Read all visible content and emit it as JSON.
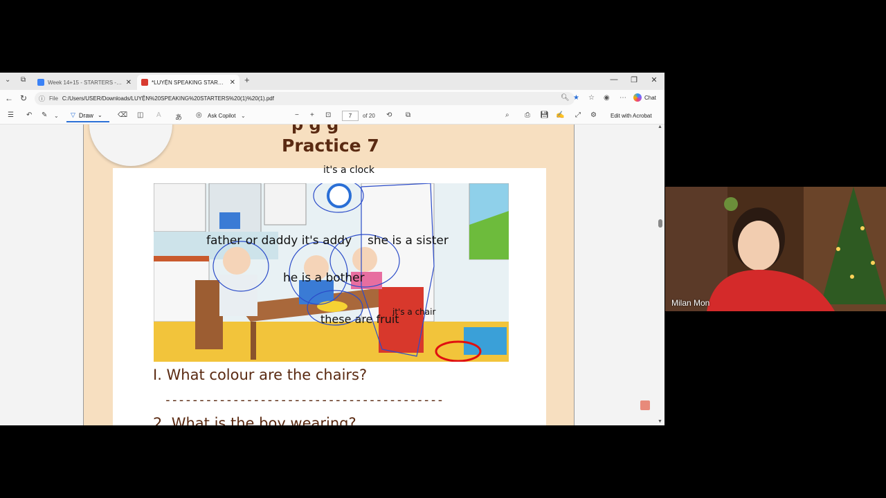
{
  "browser": {
    "tabs": [
      {
        "label": "Week 14+15 - STARTERS - Presen",
        "active": false
      },
      {
        "label": "*LUYỆN SPEAKING STARTERS (1) (",
        "active": true
      }
    ],
    "new_tab": "+",
    "url_prefix": "File",
    "url": "C:/Users/USER/Downloads/LUYỆN%20SPEAKING%20STARTERS%20(1)%20(1).pdf",
    "chat_label": "Chat"
  },
  "pdf_toolbar": {
    "draw_label": "Draw",
    "copilot_label": "Ask Copilot",
    "page_current": "7",
    "page_total": "of 20",
    "edit_label": "Edit with Acrobat"
  },
  "document": {
    "title": "Practice 7",
    "title_cut": "p          g          g",
    "question1": "I. What colour are the chairs?",
    "dashes": "-----------------------------------------",
    "question2": "2. What is the boy wearing?"
  },
  "annotations": {
    "clock": "it's a clock",
    "father": "father or daddy it's addy",
    "sister": "she is a sister",
    "brother": "he is a bother",
    "fruit": "these are fruit",
    "chair": "it's a chair"
  },
  "video": {
    "participant_name": "Milan Mon"
  },
  "colors": {
    "page_bg": "#f7dfc0",
    "title_brown": "#5a2a12",
    "ink_blue": "#2b4cc9",
    "ink_red": "#e01010",
    "draw_accent": "#2a6fd6"
  }
}
